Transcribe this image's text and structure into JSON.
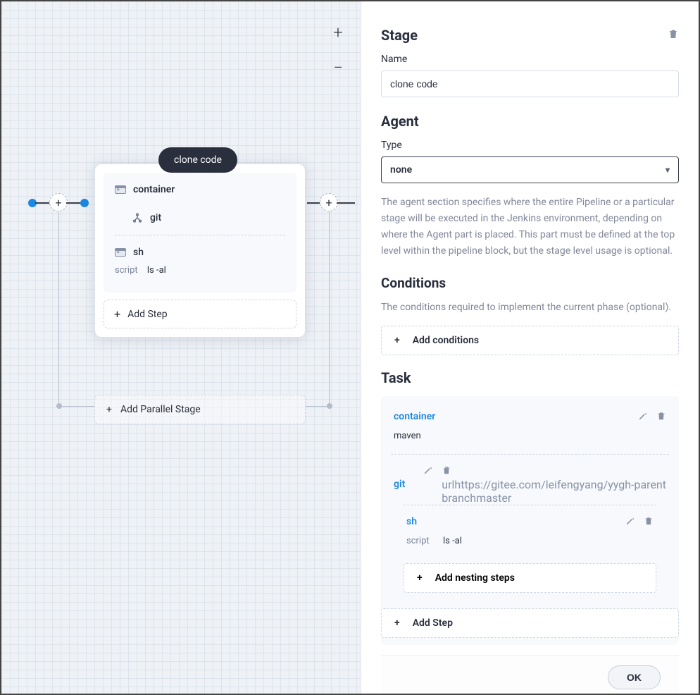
{
  "canvas": {
    "stage_label": "clone code",
    "steps": [
      {
        "icon": "terminal",
        "name": "container"
      },
      {
        "icon": "git",
        "name": "git"
      },
      {
        "icon": "terminal",
        "name": "sh",
        "param_key": "script",
        "param_val": "ls -al"
      }
    ],
    "add_step": "Add Step",
    "add_parallel": "Add Parallel Stage"
  },
  "panel": {
    "stage_heading": "Stage",
    "name_label": "Name",
    "name_value": "clone code",
    "agent_heading": "Agent",
    "type_label": "Type",
    "type_value": "none",
    "agent_help": "The agent section specifies where the entire Pipeline or a particular stage will be executed in the Jenkins environment, depending on where the Agent part is placed. This part must be defined at the top level within the pipeline block, but the stage level usage is optional.",
    "conditions_heading": "Conditions",
    "conditions_sub": "The conditions required to implement the current phase (optional).",
    "add_conditions": "Add conditions",
    "task_heading": "Task",
    "tasks": [
      {
        "name": "container",
        "params": [
          {
            "k": "",
            "v": "maven"
          }
        ]
      },
      {
        "name": "git",
        "params": [
          {
            "k": "url",
            "v": "https://gitee.com/leifengyang/yygh-parent"
          },
          {
            "k": "branch",
            "v": "master"
          }
        ]
      },
      {
        "name": "sh",
        "params": [
          {
            "k": "script",
            "v": "ls -al"
          }
        ]
      }
    ],
    "add_nesting": "Add nesting steps",
    "add_step_panel": "Add Step",
    "ok": "OK"
  }
}
